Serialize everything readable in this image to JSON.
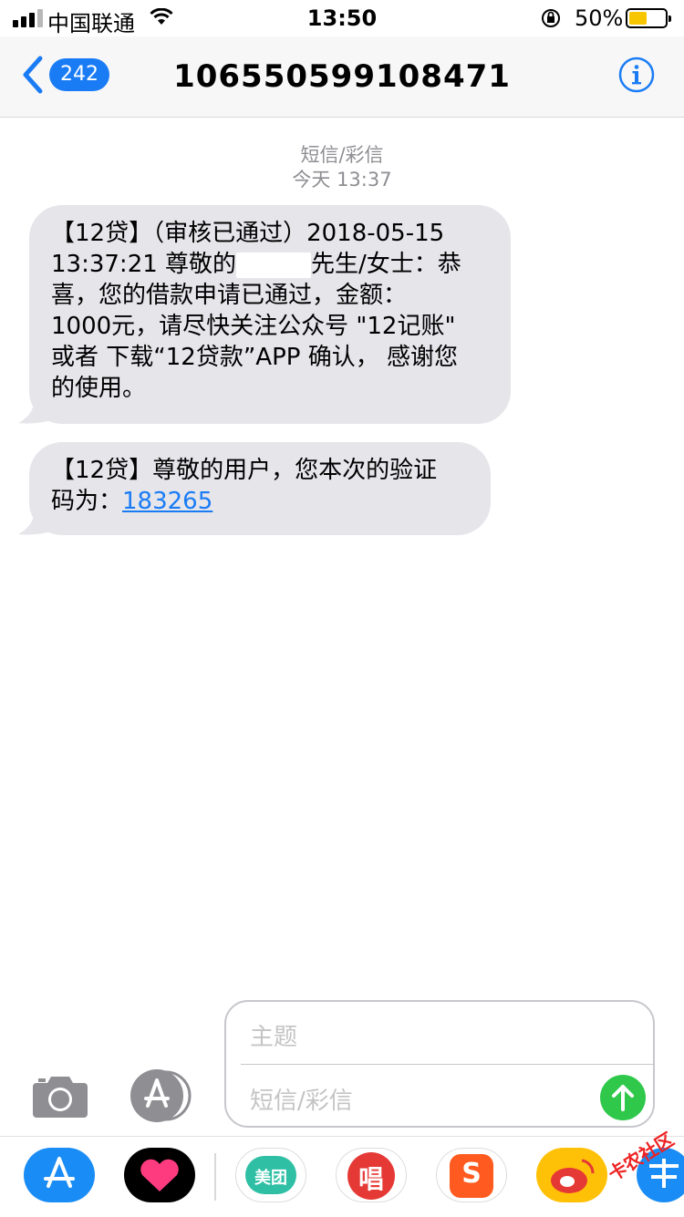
{
  "status_bar": {
    "carrier": "中国联通",
    "time": "13:50",
    "battery_percent_label": "50%",
    "battery_level": 0.5,
    "battery_color": "#f7c600"
  },
  "nav": {
    "back_count": "242",
    "title": "106550599108471",
    "accent": "#1a7cf5"
  },
  "thread_header": {
    "type_label": "短信/彩信",
    "timestamp": "今天 13:37"
  },
  "messages": [
    {
      "line1": "【12贷】（审核已通过）2018-05-15",
      "line2_pre": "13:37:21 尊敬的",
      "line2_post": "先生/女士：恭",
      "line3": "喜，您的借款申请已通过，金额：",
      "line4": "1000元，请尽快关注公众号 \"12记账\"",
      "line5": "或者 下载“12贷款”APP 确认， 感谢您",
      "line6": "的使用。"
    },
    {
      "line1": "【12贷】尊敬的用户，您本次的验证",
      "line2_pre": "码为：",
      "code": "183265"
    }
  ],
  "composer": {
    "subject_placeholder": "主题",
    "message_placeholder": "短信/彩信",
    "send_color": "#2fc84b"
  },
  "app_drawer": {
    "apps": [
      {
        "icon": "app-store-icon",
        "color": "#1a8cf5"
      },
      {
        "icon": "digital-touch-icon",
        "color": "#000000"
      },
      {
        "icon": "meituan-icon",
        "color": "#2ebfa5",
        "label": "美团"
      },
      {
        "icon": "changba-icon",
        "color": "#e53935",
        "label": "唱"
      },
      {
        "icon": "sogou-icon",
        "color": "#ff5a1f",
        "label": "S"
      },
      {
        "icon": "weibo-icon",
        "color": "#ffc107"
      },
      {
        "icon": "alipay-icon",
        "color": "#1a8cf5"
      }
    ],
    "watermark": "卡农社区"
  }
}
